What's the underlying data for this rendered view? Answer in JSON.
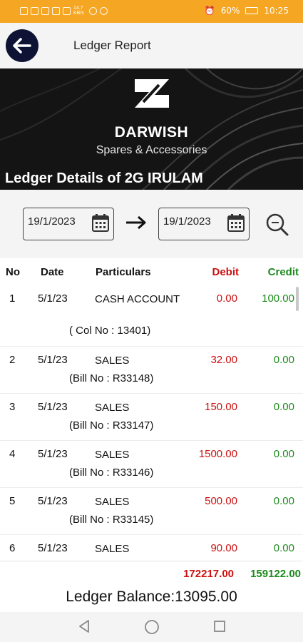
{
  "status_bar": {
    "battery": "60%",
    "time": "10:25",
    "network_speed": "14.7 KB/s"
  },
  "app_bar": {
    "title": "Ledger Report",
    "back_icon": "arrow-left-icon"
  },
  "banner": {
    "brand": "DARWISH",
    "tagline": "Spares & Accessories",
    "ledger_title": "Ledger Details of 2G IRULAM"
  },
  "filter": {
    "from_date": "19/1/2023",
    "to_date": "19/1/2023",
    "calendar_icon": "calendar-icon",
    "arrow_icon": "arrow-right-icon",
    "search_icon": "search-icon"
  },
  "table": {
    "headers": {
      "no": "No",
      "date": "Date",
      "particulars": "Particulars",
      "debit": "Debit",
      "credit": "Credit"
    },
    "rows": [
      {
        "no": "1",
        "date": "5/1/23",
        "particulars": "CASH ACCOUNT",
        "ref": "( Col No :  13401)",
        "debit": "0.00",
        "credit": "100.00"
      },
      {
        "no": "2",
        "date": "5/1/23",
        "particulars": "SALES",
        "ref": "(Bill No : R33148)",
        "debit": "32.00",
        "credit": "0.00"
      },
      {
        "no": "3",
        "date": "5/1/23",
        "particulars": "SALES",
        "ref": "(Bill No : R33147)",
        "debit": "150.00",
        "credit": "0.00"
      },
      {
        "no": "4",
        "date": "5/1/23",
        "particulars": "SALES",
        "ref": "(Bill No : R33146)",
        "debit": "1500.00",
        "credit": "0.00"
      },
      {
        "no": "5",
        "date": "5/1/23",
        "particulars": "SALES",
        "ref": "(Bill No : R33145)",
        "debit": "500.00",
        "credit": "0.00"
      },
      {
        "no": "6",
        "date": "5/1/23",
        "particulars": "SALES",
        "ref": "",
        "debit": "90.00",
        "credit": "0.00"
      }
    ]
  },
  "totals": {
    "debit": "172217.00",
    "credit": "159122.00",
    "balance": "Ledger Balance:13095.00"
  },
  "nav": {
    "back": "nav-back-icon",
    "home": "nav-home-icon",
    "recents": "nav-recents-icon"
  },
  "colors": {
    "status_bar": "#f5a623",
    "back_button": "#0e1335",
    "debit": "#cc1111",
    "credit": "#1c8a1c"
  }
}
